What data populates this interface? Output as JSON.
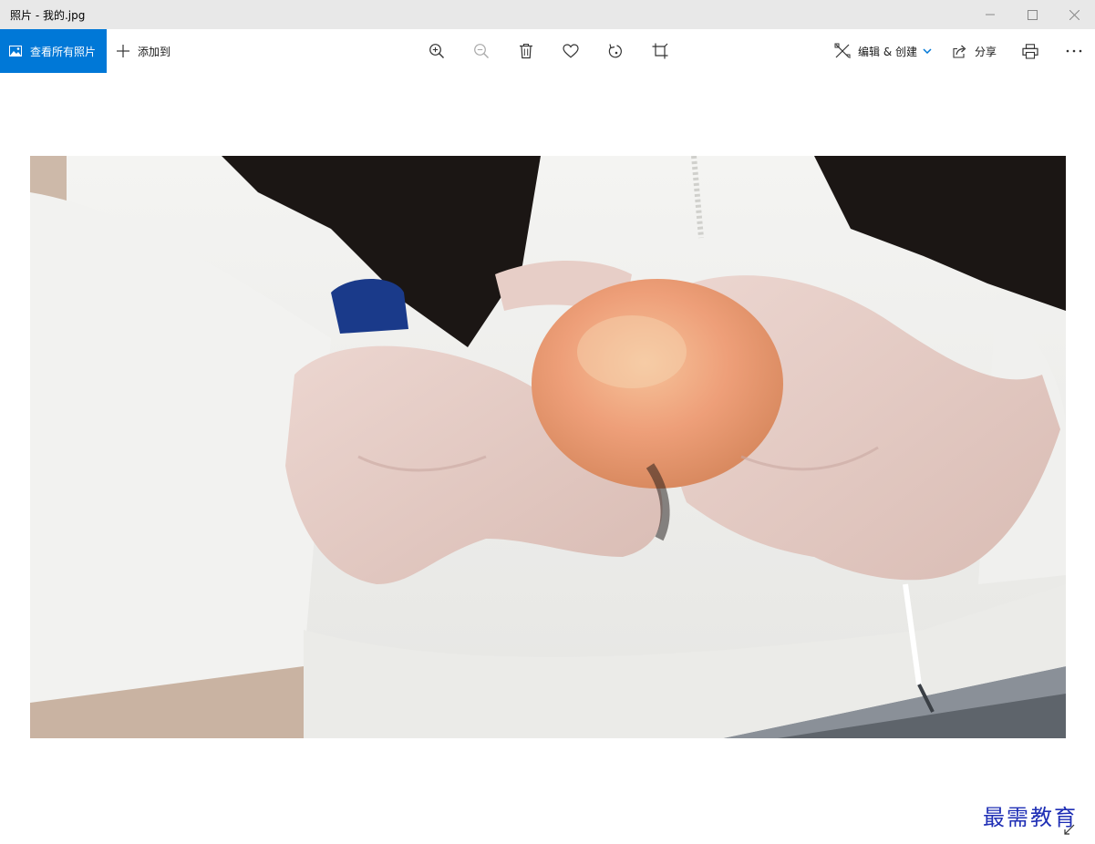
{
  "window": {
    "title": "照片 - 我的.jpg"
  },
  "toolbar": {
    "view_all_label": "查看所有照片",
    "add_to_label": "添加到",
    "edit_create_label": "编辑 & 创建",
    "share_label": "分享",
    "icons": [
      "zoom-in-icon",
      "zoom-out-icon",
      "delete-icon",
      "heart-icon",
      "rotate-icon",
      "crop-icon",
      "print-icon",
      "more-icon"
    ]
  },
  "colors": {
    "accent": "#0078d7",
    "titlebar": "#e8e8e8",
    "watermark": "#1f2fb5"
  },
  "watermark": {
    "text": "最需教育"
  }
}
